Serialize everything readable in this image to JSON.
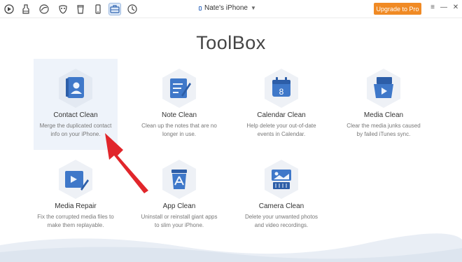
{
  "toolbar": {
    "device_name": "Nate's iPhone",
    "upgrade_label": "Upgrade to Pro",
    "icons": [
      "quick-start-icon",
      "backup-icon",
      "music-icon",
      "mask-icon",
      "cup-icon",
      "phone-icon",
      "toolbox-icon",
      "history-icon"
    ],
    "window_controls": [
      "≡",
      "—",
      "✕"
    ]
  },
  "page": {
    "title": "ToolBox"
  },
  "cards": [
    {
      "title": "Contact Clean",
      "desc": "Merge the duplicated contact info on your iPhone.",
      "icon": "contact-icon"
    },
    {
      "title": "Note Clean",
      "desc": "Clean up the notes that are no longer in use.",
      "icon": "note-icon"
    },
    {
      "title": "Calendar Clean",
      "desc": "Help delete your out-of-date events in Calendar.",
      "icon": "calendar-icon",
      "calendar_day": "8"
    },
    {
      "title": "Media Clean",
      "desc": "Clear the media junks caused by failed iTunes sync.",
      "icon": "media-icon"
    },
    {
      "title": "Media Repair",
      "desc": "Fix the corrupted media files to make them replayable.",
      "icon": "media-repair-icon"
    },
    {
      "title": "App Clean",
      "desc": "Uninstall or reinstall giant apps to slim your iPhone.",
      "icon": "app-icon"
    },
    {
      "title": "Camera Clean",
      "desc": "Delete your unwanted photos and video recordings.",
      "icon": "camera-icon"
    }
  ],
  "colors": {
    "accent": "#f08a24",
    "icon_blue": "#3f78c9",
    "hex_bg": "#eef1f6"
  }
}
